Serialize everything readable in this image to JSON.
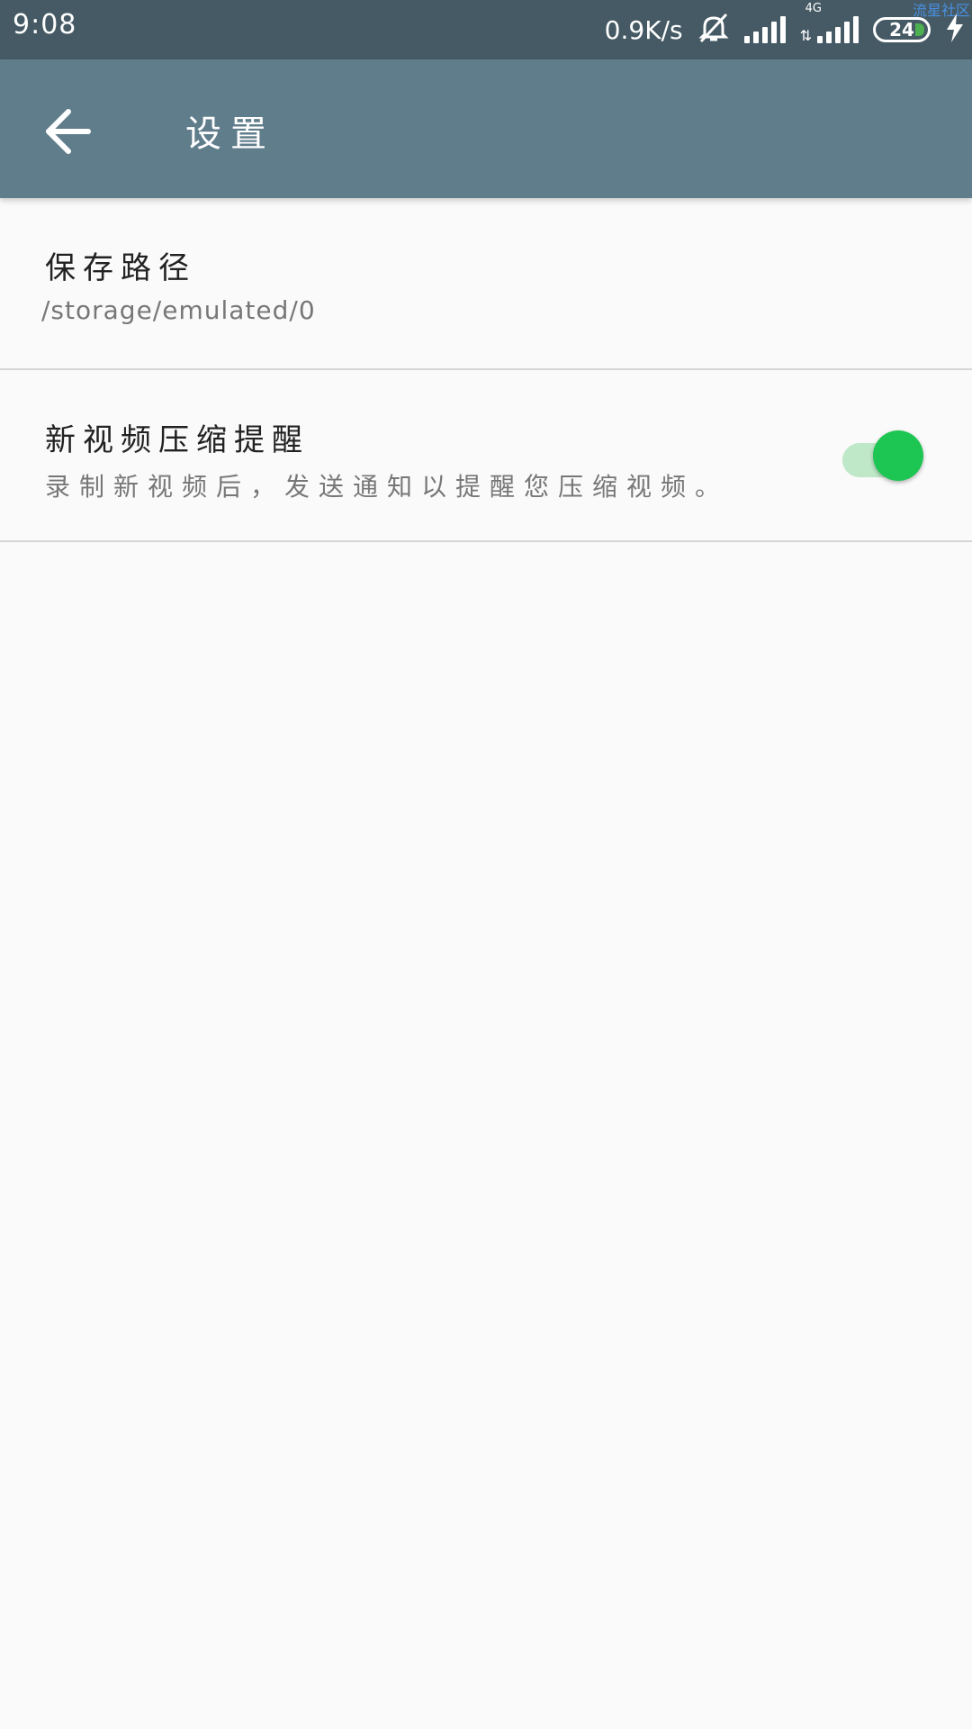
{
  "status_bar": {
    "time": "9:08",
    "net_speed": "0.9K/s",
    "network_type": "4G",
    "battery_level": "24",
    "watermark": "流星社区",
    "icons": [
      "mute-bell-icon",
      "signal-icon",
      "lte-signal-icon",
      "battery-icon",
      "charging-icon"
    ]
  },
  "app_bar": {
    "title": "设置",
    "back_icon": "arrow-left-icon"
  },
  "settings": {
    "items": [
      {
        "title": "保存路径",
        "summary": "/storage/emulated/0"
      },
      {
        "title": "新视频压缩提醒",
        "summary": "录制新视频后，发送通知以提醒您压缩视频。",
        "toggle_on": true
      }
    ]
  },
  "colors": {
    "status_bar": "#455a64",
    "app_bar": "#607d8b",
    "toggle_on": "#1dc552",
    "toggle_track": "#bfe8c9",
    "background": "#fafafa"
  }
}
